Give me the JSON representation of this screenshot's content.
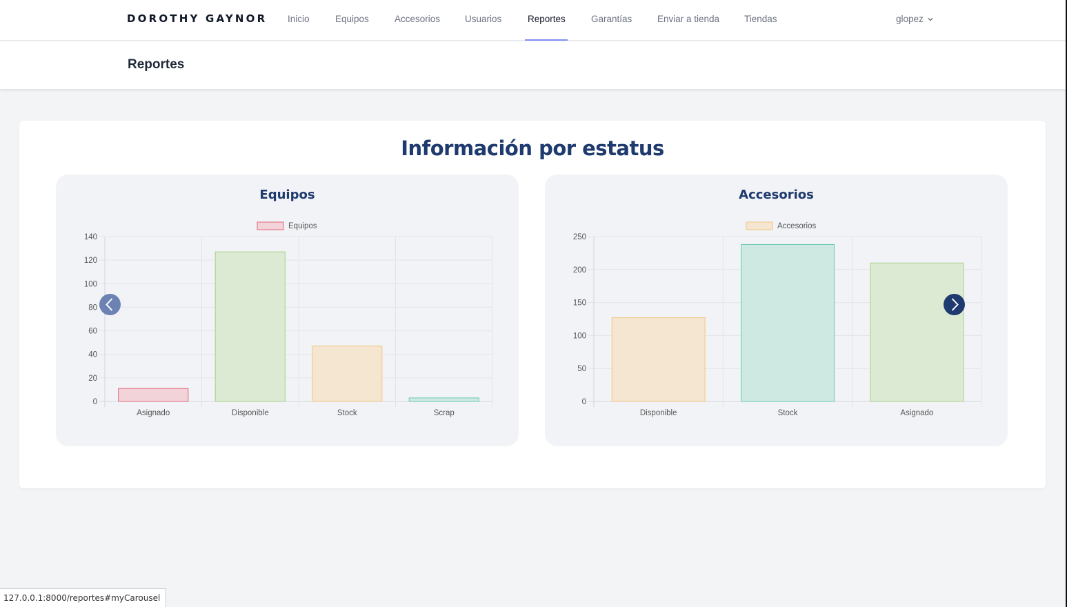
{
  "nav": {
    "brand": "DOROTHY GAYNOR",
    "links": [
      "Inicio",
      "Equipos",
      "Accesorios",
      "Usuarios",
      "Reportes",
      "Garantías",
      "Enviar a tienda",
      "Tiendas"
    ],
    "active": "Reportes",
    "user": "glopez"
  },
  "header": {
    "title": "Reportes"
  },
  "main": {
    "title": "Información por estatus"
  },
  "chart_data": [
    {
      "type": "bar",
      "title": "Equipos",
      "categories": [
        "Asignado",
        "Disponible",
        "Stock",
        "Scrap"
      ],
      "series": [
        {
          "name": "Equipos",
          "values": [
            11,
            127,
            47,
            3
          ]
        }
      ],
      "ylim": [
        0,
        140
      ],
      "yticks": [
        "0",
        "20",
        "40",
        "60",
        "80",
        "100",
        "120",
        "140"
      ],
      "legend": "top-center",
      "grid": true,
      "colors": {
        "fill": [
          "#f2d3da",
          "#dce9d3",
          "#f5e6d1",
          "#cde9e2"
        ],
        "stroke": [
          "#e06a7b",
          "#a8cf8b",
          "#f2c680",
          "#6cc9b0"
        ]
      }
    },
    {
      "type": "bar",
      "title": "Accesorios",
      "categories": [
        "Disponible",
        "Stock",
        "Asignado"
      ],
      "series": [
        {
          "name": "Accesorios",
          "values": [
            127,
            238,
            210
          ]
        }
      ],
      "ylim": [
        0,
        250
      ],
      "yticks": [
        "0",
        "50",
        "100",
        "150",
        "200",
        "250"
      ],
      "legend": "top-center",
      "grid": true,
      "colors": {
        "fill": [
          "#f5e6d1",
          "#cde9e2",
          "#dce9d3"
        ],
        "stroke": [
          "#f2c680",
          "#6cc9b0",
          "#a8cf8b"
        ]
      }
    }
  ],
  "statusbar": {
    "url": "127.0.0.1:8000/reportes#myCarousel"
  },
  "icons": {
    "prev": "chevron-left-icon",
    "next": "chevron-right-icon",
    "user_menu": "chevron-down-icon"
  },
  "theme": {
    "accent": "#1e3a6e",
    "active_underline": "#818cf8"
  }
}
